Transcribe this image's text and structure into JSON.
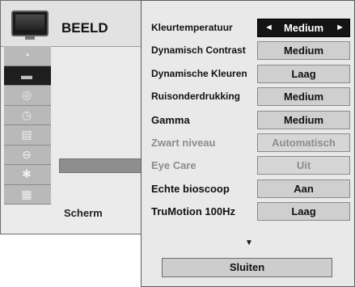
{
  "left_panel": {
    "title": "BEELD",
    "header_icon": "tv-icon",
    "categories": [
      {
        "icon": "satellite-dish-icon",
        "glyph": "◔",
        "active": false
      },
      {
        "icon": "tv-screen-icon",
        "glyph": "▬",
        "active": true
      },
      {
        "icon": "audio-disc-icon",
        "glyph": "◎",
        "active": false
      },
      {
        "icon": "clock-icon",
        "glyph": "◷",
        "active": false
      },
      {
        "icon": "calendar-icon",
        "glyph": "▤",
        "active": false
      },
      {
        "icon": "lock-icon",
        "glyph": "⊖",
        "active": false
      },
      {
        "icon": "bluetooth-icon",
        "glyph": "✱",
        "active": false
      },
      {
        "icon": "movie-clapper-icon",
        "glyph": "▦",
        "active": false
      }
    ],
    "label": "Scherm"
  },
  "menu": {
    "rows": [
      {
        "label": "Kleurtemperatuur",
        "value": "Medium",
        "state": "selected"
      },
      {
        "label": "Dynamisch Contrast",
        "value": "Medium",
        "state": "normal"
      },
      {
        "label": "Dynamische Kleuren",
        "value": "Laag",
        "state": "normal"
      },
      {
        "label": "Ruisonderdrukking",
        "value": "Medium",
        "state": "normal"
      },
      {
        "label": "Gamma",
        "value": "Medium",
        "state": "normal"
      },
      {
        "label": "Zwart niveau",
        "value": "Automatisch",
        "state": "disabled"
      },
      {
        "label": "Eye Care",
        "value": "Uit",
        "state": "disabled"
      },
      {
        "label": "Echte bioscoop",
        "value": "Aan",
        "state": "normal"
      },
      {
        "label": "TruMotion 100Hz",
        "value": "Laag",
        "state": "normal"
      }
    ],
    "arrow_left": "◄",
    "arrow_right": "►",
    "more_indicator": "▼",
    "close_label": "Sluiten"
  }
}
